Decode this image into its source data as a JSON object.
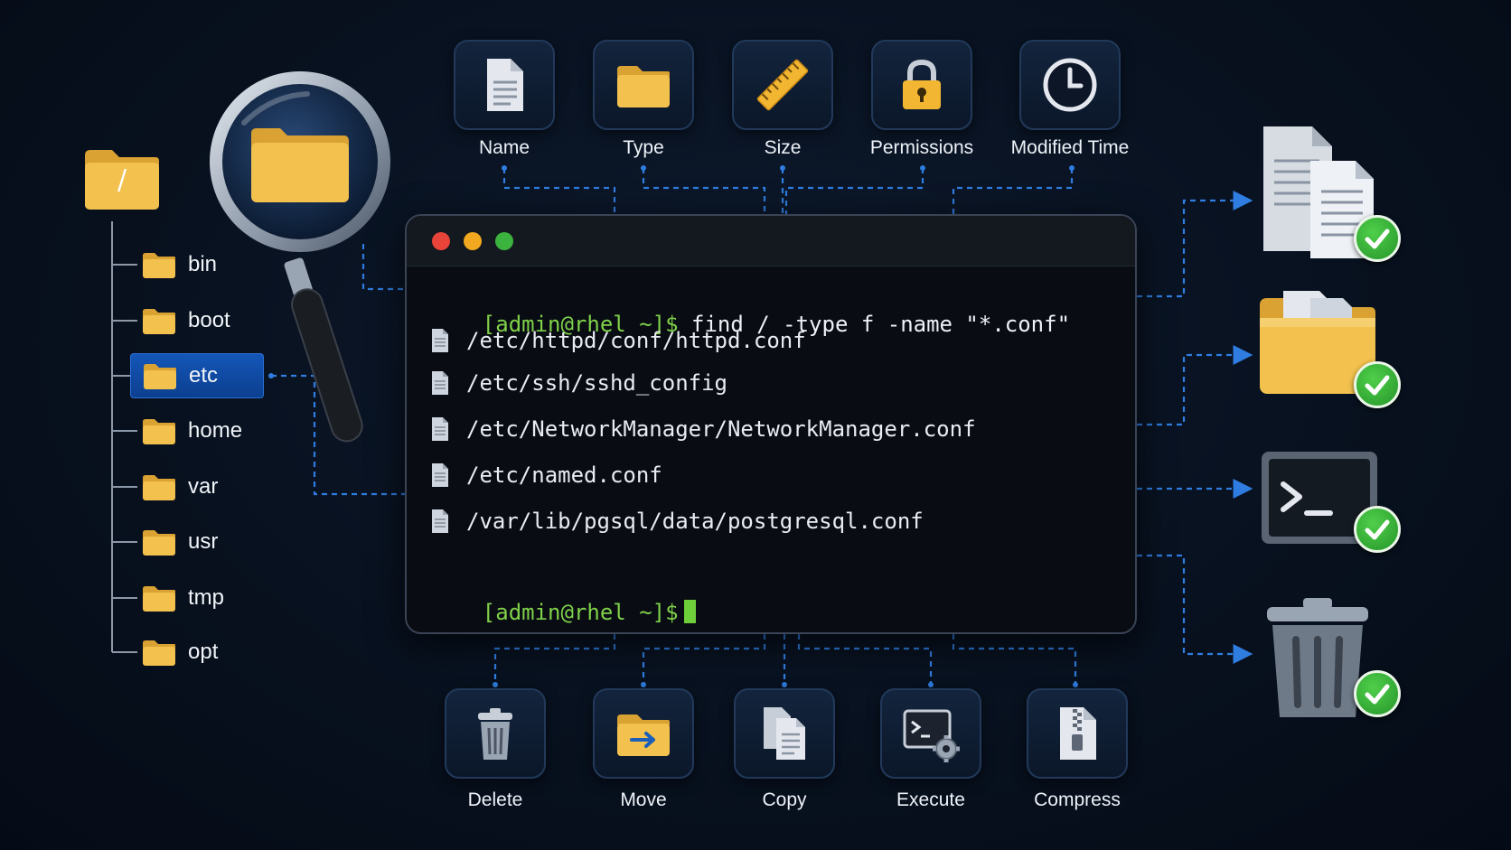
{
  "tree": {
    "root_label": "/",
    "items": [
      "bin",
      "boot",
      "etc",
      "home",
      "var",
      "usr",
      "tmp",
      "opt"
    ],
    "selected": "etc"
  },
  "attributes": [
    "Name",
    "Type",
    "Size",
    "Permissions",
    "Modified Time"
  ],
  "actions": [
    "Delete",
    "Move",
    "Copy",
    "Execute",
    "Compress"
  ],
  "terminal": {
    "prompt": "[admin@rhel ~]$",
    "command": "find / -type f -name \"*.conf\"",
    "results": [
      "/etc/httpd/conf/httpd.conf",
      "/etc/ssh/sshd_config",
      "/etc/NetworkManager/NetworkManager.conf",
      "/etc/named.conf",
      "/var/lib/pgsql/data/postgresql.conf"
    ]
  },
  "outcomes": [
    "documents-icon",
    "folder-icon",
    "terminal-icon",
    "trash-icon"
  ],
  "colors": {
    "background": "#08111f",
    "prompt": "#7fd14a",
    "connector": "#2f7de0",
    "selected": "#1456b8",
    "folder": "#f2c14e",
    "check": "#2fa82f"
  }
}
